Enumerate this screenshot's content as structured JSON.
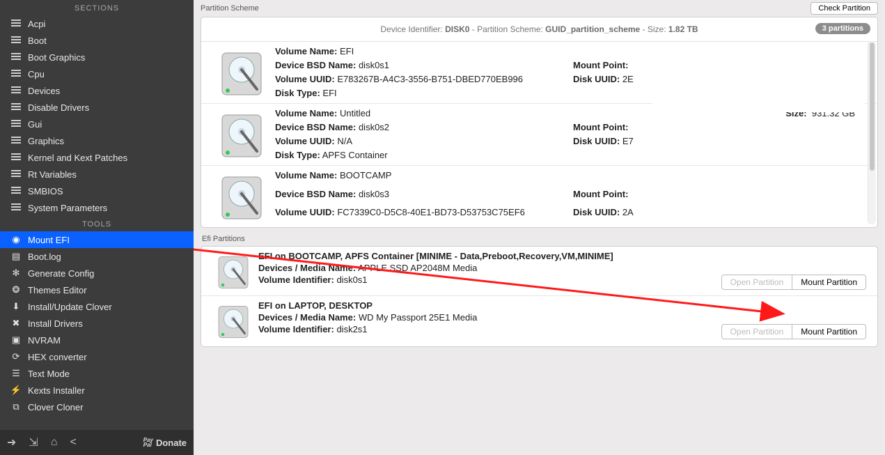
{
  "sidebar": {
    "sections_header": "SECTIONS",
    "tools_header": "TOOLS",
    "sections": [
      {
        "label": "Acpi",
        "icon": "list"
      },
      {
        "label": "Boot",
        "icon": "list"
      },
      {
        "label": "Boot Graphics",
        "icon": "list"
      },
      {
        "label": "Cpu",
        "icon": "list"
      },
      {
        "label": "Devices",
        "icon": "list"
      },
      {
        "label": "Disable Drivers",
        "icon": "list"
      },
      {
        "label": "Gui",
        "icon": "list"
      },
      {
        "label": "Graphics",
        "icon": "list"
      },
      {
        "label": "Kernel and Kext Patches",
        "icon": "list"
      },
      {
        "label": "Rt Variables",
        "icon": "list"
      },
      {
        "label": "SMBIOS",
        "icon": "list"
      },
      {
        "label": "System Parameters",
        "icon": "list"
      }
    ],
    "tools": [
      {
        "label": "Mount EFI",
        "icon": "disk",
        "selected": true
      },
      {
        "label": "Boot.log",
        "icon": "log"
      },
      {
        "label": "Generate Config",
        "icon": "gear"
      },
      {
        "label": "Themes Editor",
        "icon": "globe"
      },
      {
        "label": "Install/Update Clover",
        "icon": "download"
      },
      {
        "label": "Install Drivers",
        "icon": "wrench"
      },
      {
        "label": "NVRAM",
        "icon": "chip"
      },
      {
        "label": "HEX converter",
        "icon": "reload"
      },
      {
        "label": "Text Mode",
        "icon": "text"
      },
      {
        "label": "Kexts Installer",
        "icon": "plug"
      },
      {
        "label": "Clover Cloner",
        "icon": "copy"
      }
    ],
    "donate": "Donate"
  },
  "top": {
    "title": "Partition Scheme",
    "check_btn": "Check Partition"
  },
  "scheme": {
    "header_prefix": "Device Identifier: ",
    "device_id": "DISK0",
    "sep": " - ",
    "ps_label": "Partition Scheme: ",
    "ps_value": "GUID_partition_scheme",
    "size_label": " - Size: ",
    "size_value": "1.82 TB",
    "badge": "3 partitions",
    "labels": {
      "vol_name": "Volume Name:",
      "bsd": "Device BSD Name:",
      "uuid": "Volume UUID:",
      "dtype": "Disk Type:",
      "mount": "Mount Point:",
      "duuid": "Disk UUID:",
      "size": "Size:"
    },
    "rows": [
      {
        "vol_name": "EFI",
        "bsd": "disk0s1",
        "uuid": "E783267B-A4C3-3556-B751-DBED770EB996",
        "dtype": "EFI",
        "mount": "",
        "duuid": "2E",
        "size": ""
      },
      {
        "vol_name": "Untitled",
        "bsd": "disk0s2",
        "uuid": "N/A",
        "dtype": "APFS Container",
        "mount": "",
        "duuid": "E7",
        "size": "931.32 GB"
      },
      {
        "vol_name": "BOOTCAMP",
        "bsd": "disk0s3",
        "uuid": "FC7339C0-D5C8-40E1-BD73-D53753C75EF6",
        "dtype": "",
        "mount": "",
        "duuid": "2A",
        "size": ""
      }
    ]
  },
  "efi": {
    "title": "Efi Partitions",
    "labels": {
      "media": "Devices / Media Name:",
      "vid": "Volume Identifier:"
    },
    "btn_open": "Open Partition",
    "btn_mount": "Mount Partition",
    "rows": [
      {
        "title": "EFI on BOOTCAMP, APFS Container [MINIME - Data,Preboot,Recovery,VM,MINIME]",
        "media": "APPLE SSD AP2048M Media",
        "vid": "disk0s1"
      },
      {
        "title": "EFI on LAPTOP, DESKTOP",
        "media": "WD My Passport 25E1 Media",
        "vid": "disk2s1"
      }
    ]
  }
}
